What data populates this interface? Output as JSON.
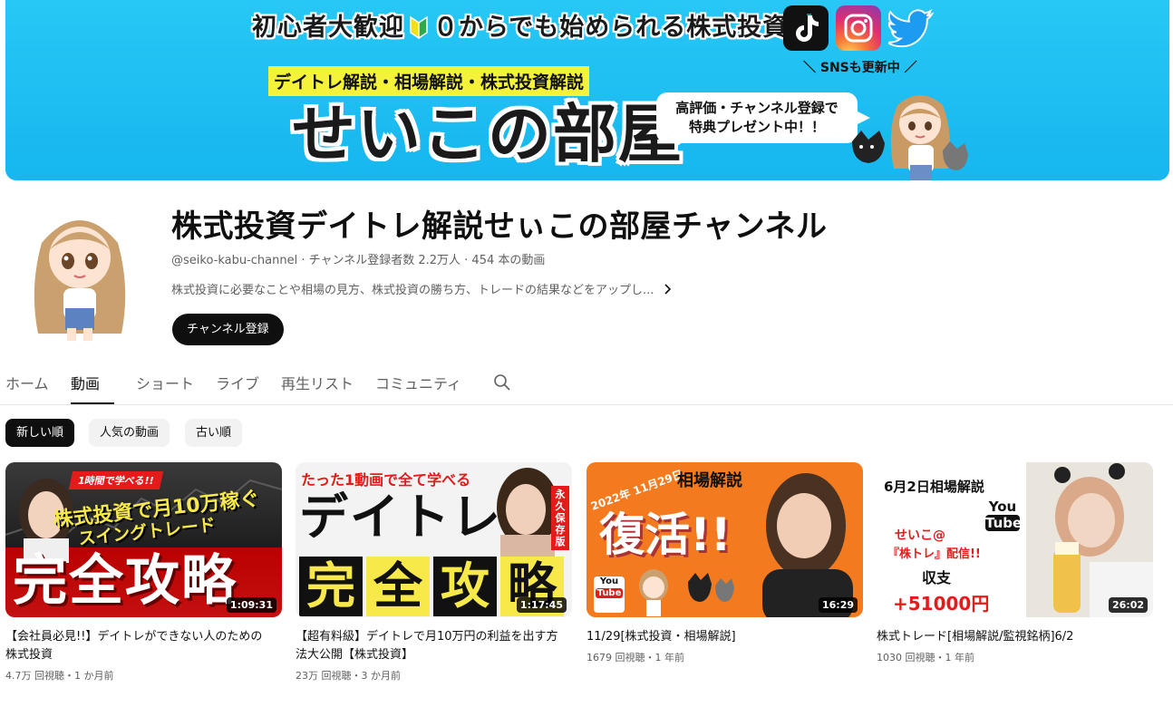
{
  "banner": {
    "top_line_left": "初心者大歓迎",
    "top_line_right": "０からでも始められる株式投資",
    "sub_line": "デイトレ解説・相場解説・株式投資解説",
    "title": "せいこの部屋",
    "sns_caption": "＼ SNSも更新中 ／",
    "bubble_line1": "高評価・チャンネル登録で",
    "bubble_line2": "特典プレゼント中！！"
  },
  "channel": {
    "name": "株式投資デイトレ解説せぃこの部屋チャンネル",
    "meta": "@seiko-kabu-channel ‧ チャンネル登録者数 2.2万人 ‧ 454 本の動画",
    "description": "株式投資に必要なことや相場の見方、株式投資の勝ち方、トレードの結果などをアップし...",
    "subscribe_label": "チャンネル登録"
  },
  "tabs": [
    {
      "label": "ホーム"
    },
    {
      "label": "動画"
    },
    {
      "label": "ショート"
    },
    {
      "label": "ライブ"
    },
    {
      "label": "再生リスト"
    },
    {
      "label": "コミュニティ"
    }
  ],
  "chips": [
    {
      "label": "新しい順"
    },
    {
      "label": "人気の動画"
    },
    {
      "label": "古い順"
    }
  ],
  "videos": [
    {
      "title": "【会社員必見!!】デイトレができない人のための株式投資",
      "meta": "4.7万 回視聴・1 か月前",
      "duration": "1:09:31",
      "thumb_text": {
        "tag": "1時間で学べる!!",
        "line1": "株式投資で月10万稼ぐ",
        "line2": "スイングトレード",
        "big": "完全攻略"
      }
    },
    {
      "title": "【超有料級】デイトレで月10万円の利益を出す方法大公開【株式投資】",
      "meta": "23万 回視聴・3 か月前",
      "duration": "1:17:45",
      "thumb_text": {
        "tag": "たった1動画で全て学べる",
        "line1": "デイトレ",
        "badge": "永久保存版",
        "big1": "完",
        "big2": "全",
        "big3": "攻",
        "big4": "略"
      }
    },
    {
      "title": "11/29[株式投資・相場解説]",
      "meta": "1679 回視聴・1 年前",
      "duration": "16:29",
      "thumb_text": {
        "date": "2022年 11月29日",
        "tag": "相場解説",
        "big": "復活!!",
        "yt1": "You",
        "yt2": "Tube"
      }
    },
    {
      "title": "株式トレード[相場解説/監視銘柄]6/2",
      "meta": "1030 回視聴・1 年前",
      "duration": "26:02",
      "thumb_text": {
        "tag": "6月2日相場解説",
        "yt1": "You",
        "yt2": "Tube",
        "line1": "せいこ@",
        "line2": "『株トレ』配信!!",
        "line3": "収支",
        "big": "+51000円"
      }
    }
  ],
  "colors": {
    "banner": "#1fbff3",
    "accent_red": "#e31b1b",
    "orange": "#f47a20"
  }
}
